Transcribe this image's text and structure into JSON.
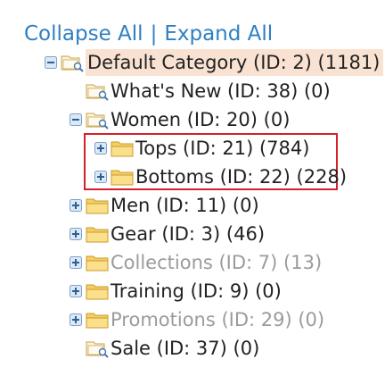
{
  "controls": {
    "collapse_all": "Collapse All",
    "separator": "|",
    "expand_all": "Expand All"
  },
  "tree": [
    {
      "label": "Default Category (ID: 2) (1181)",
      "toggle": "minus",
      "icon": "folder-search-open",
      "state": "selected"
    },
    {
      "label": "What's New (ID: 38) (0)",
      "toggle": "none",
      "icon": "folder-search",
      "state": "normal"
    },
    {
      "label": "Women (ID: 20) (0)",
      "toggle": "minus",
      "icon": "folder-search-open",
      "state": "normal"
    },
    {
      "label": "Tops (ID: 21) (784)",
      "toggle": "plus",
      "icon": "folder",
      "state": "normal"
    },
    {
      "label": "Bottoms (ID: 22) (228)",
      "toggle": "plus",
      "icon": "folder",
      "state": "normal"
    },
    {
      "label": "Men (ID: 11) (0)",
      "toggle": "plus",
      "icon": "folder",
      "state": "normal"
    },
    {
      "label": "Gear (ID: 3) (46)",
      "toggle": "plus",
      "icon": "folder",
      "state": "normal"
    },
    {
      "label": "Collections (ID: 7) (13)",
      "toggle": "plus",
      "icon": "folder",
      "state": "disabled"
    },
    {
      "label": "Training (ID: 9) (0)",
      "toggle": "plus",
      "icon": "folder",
      "state": "normal"
    },
    {
      "label": "Promotions (ID: 29) (0)",
      "toggle": "plus",
      "icon": "folder",
      "state": "disabled"
    },
    {
      "label": "Sale (ID: 37) (0)",
      "toggle": "none",
      "icon": "folder-search",
      "state": "normal"
    }
  ],
  "colors": {
    "link": "#2f7fc1",
    "selected_bg": "#f9e2d2",
    "highlight_border": "#d4202a",
    "disabled_text": "#9b9b9b"
  }
}
